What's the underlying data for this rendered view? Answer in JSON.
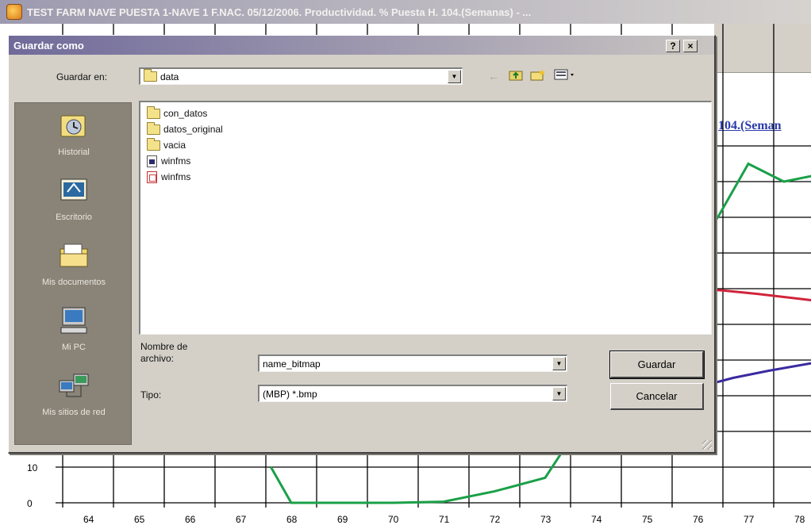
{
  "app": {
    "title": "TEST FARM NAVE PUESTA 1-NAVE 1 F.NAC. 05/12/2006. Productividad. % Puesta H. 104.(Semanas) - ..."
  },
  "chart": {
    "title_fragment": "104.(Seman",
    "y_tick_labels": [
      "10",
      "0"
    ]
  },
  "chart_data": {
    "type": "line",
    "x": [
      64,
      65,
      66,
      67,
      68,
      69,
      70,
      71,
      72,
      73,
      74,
      75,
      76,
      77,
      78
    ],
    "xlabels": [
      "64",
      "65",
      "66",
      "67",
      "68",
      "69",
      "70",
      "71",
      "72",
      "73",
      "74",
      "75",
      "76",
      "77",
      "78"
    ],
    "ylim_visible": [
      0,
      10
    ],
    "series": [
      {
        "color": "#1aa048",
        "points": [
          [
            67.6,
            10
          ],
          [
            68,
            0
          ],
          [
            69,
            0
          ],
          [
            70,
            0
          ],
          [
            71,
            0.3
          ],
          [
            72,
            3.2
          ],
          [
            73,
            7
          ],
          [
            75.9,
            70
          ],
          [
            76.4,
            80
          ],
          [
            77,
            95
          ],
          [
            77.7,
            90
          ],
          [
            78.4,
            92
          ]
        ]
      },
      {
        "color": "#d0243c",
        "points": [
          [
            75.9,
            60
          ],
          [
            76.5,
            59.5
          ],
          [
            77.2,
            58.5
          ],
          [
            78.4,
            56.5
          ]
        ]
      },
      {
        "color": "#3a2aa0",
        "points": [
          [
            75.9,
            32
          ],
          [
            76.7,
            35
          ],
          [
            77.4,
            37
          ],
          [
            78.4,
            39.5
          ]
        ]
      }
    ],
    "grid": true
  },
  "dialog": {
    "title": "Guardar como",
    "help_button": "?",
    "close_button": "×",
    "save_in_label": "Guardar en:",
    "current_folder": "data",
    "places": [
      {
        "label": "Historial",
        "icon": "history-icon"
      },
      {
        "label": "Escritorio",
        "icon": "desktop-icon"
      },
      {
        "label": "Mis documentos",
        "icon": "my-documents-icon"
      },
      {
        "label": "Mi PC",
        "icon": "my-computer-icon"
      },
      {
        "label": "Mis sitios de red",
        "icon": "network-places-icon"
      }
    ],
    "files": [
      {
        "name": "con_datos",
        "type": "folder"
      },
      {
        "name": "datos_original",
        "type": "folder"
      },
      {
        "name": "vacia",
        "type": "folder"
      },
      {
        "name": "winfms",
        "type": "app"
      },
      {
        "name": "winfms",
        "type": "bmp"
      }
    ],
    "filename_label_line1": "Nombre de",
    "filename_label_line2": "archivo:",
    "filename_value": "name_bitmap",
    "type_label": "Tipo:",
    "type_value": "(MBP) *.bmp",
    "save_button": "Guardar",
    "cancel_button": "Cancelar"
  }
}
